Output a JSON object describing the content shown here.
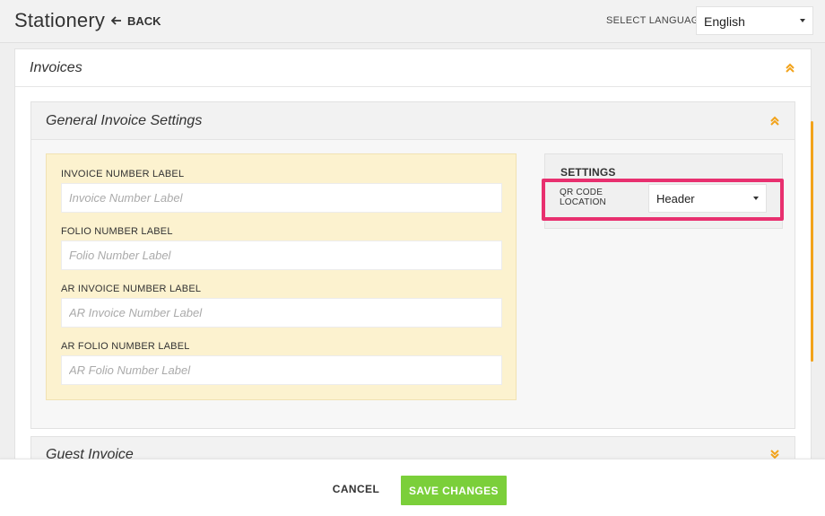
{
  "header": {
    "title": "Stationery",
    "back_label": "BACK",
    "language_label": "SELECT LANGUAGE",
    "language_value": "English"
  },
  "invoices_panel": {
    "title": "Invoices",
    "expanded": true
  },
  "general_settings": {
    "title": "General Invoice Settings",
    "expanded": true,
    "fields": [
      {
        "label": "INVOICE NUMBER LABEL",
        "placeholder": "Invoice Number Label",
        "value": ""
      },
      {
        "label": "FOLIO NUMBER LABEL",
        "placeholder": "Folio Number Label",
        "value": ""
      },
      {
        "label": "AR INVOICE NUMBER LABEL",
        "placeholder": "AR Invoice Number Label",
        "value": ""
      },
      {
        "label": "AR FOLIO NUMBER LABEL",
        "placeholder": "AR Folio Number Label",
        "value": ""
      }
    ],
    "settings": {
      "title": "SETTINGS",
      "qr_label": "QR CODE LOCATION",
      "qr_value": "Header"
    }
  },
  "guest_invoice": {
    "title": "Guest Invoice",
    "expanded": false
  },
  "footer": {
    "cancel_label": "CANCEL",
    "save_label": "SAVE CHANGES"
  },
  "colors": {
    "accent": "#f2a31b",
    "save_green": "#7bcf3a",
    "highlight_pink": "#e8306f",
    "field_box_yellow": "#fcf2cf"
  },
  "icons": {
    "back": "arrow-left-icon",
    "collapse": "chevron-double-up-icon",
    "expand": "chevron-double-down-icon",
    "dropdown": "caret-down-icon"
  }
}
